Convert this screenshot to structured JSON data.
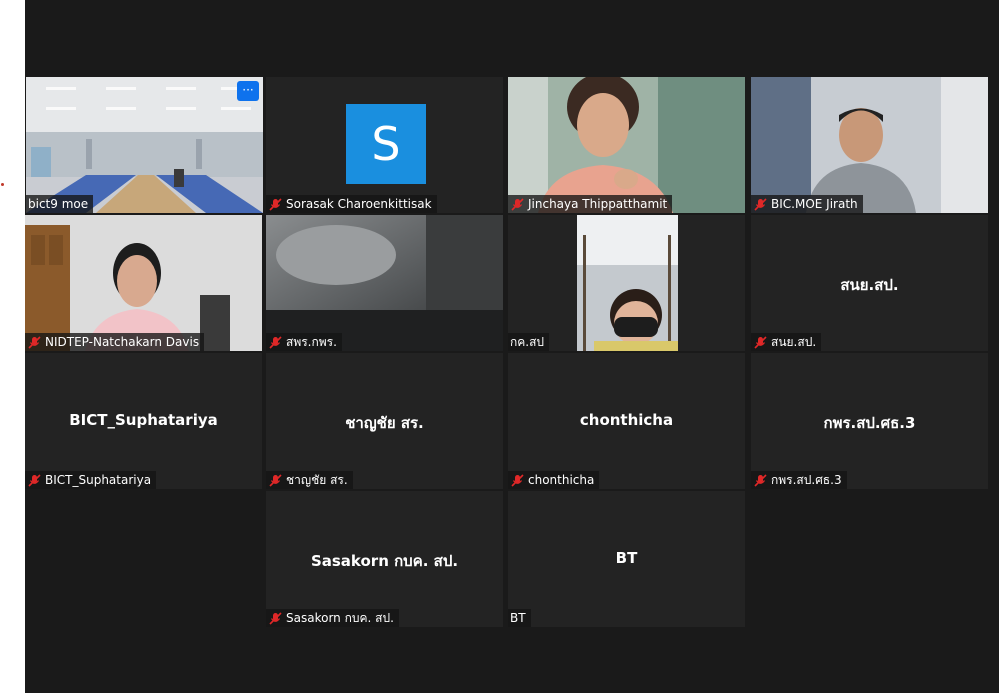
{
  "participants": [
    {
      "name": "bict9 moe",
      "type": "video",
      "muted": false,
      "active": true
    },
    {
      "name": "Sorasak Charoenkittisak",
      "type": "avatar",
      "avatar_letter": "S",
      "muted": true
    },
    {
      "name": "Jinchaya Thippatthamit",
      "type": "video",
      "muted": true
    },
    {
      "name": "BIC.MOE Jirath",
      "type": "video",
      "muted": true
    },
    {
      "name": "NIDTEP-Natchakarn Davis",
      "type": "video",
      "muted": true
    },
    {
      "name": "สพร.กพร.",
      "type": "video",
      "muted": true
    },
    {
      "name": "กค.สป",
      "type": "video",
      "muted": false
    },
    {
      "name": "สนย.สป.",
      "display_name": "สนย.สป.",
      "type": "name",
      "muted": true
    },
    {
      "name": "BICT_Suphatariya",
      "display_name": "BICT_Suphatariya",
      "type": "name",
      "muted": true
    },
    {
      "name": "ชาญชัย สร.",
      "display_name": "ชาญชัย สร.",
      "type": "name",
      "muted": true
    },
    {
      "name": "chonthicha",
      "display_name": "chonthicha",
      "type": "name",
      "muted": true
    },
    {
      "name": "กพร.สป.ศธ.3",
      "display_name": "กพร.สป.ศธ.3",
      "type": "name",
      "muted": true
    },
    {
      "name": "Sasakorn กบค. สป.",
      "display_name": "Sasakorn กบค. สป.",
      "type": "name",
      "muted": true
    },
    {
      "name": "BT",
      "display_name": "BT",
      "type": "name",
      "muted": false
    }
  ],
  "more_button_label": "···",
  "colors": {
    "background": "#1a1a1a",
    "tile": "#232323",
    "active_border": "#d6e77a",
    "muted_icon": "#e02828",
    "avatar": "#1a8fdf"
  }
}
